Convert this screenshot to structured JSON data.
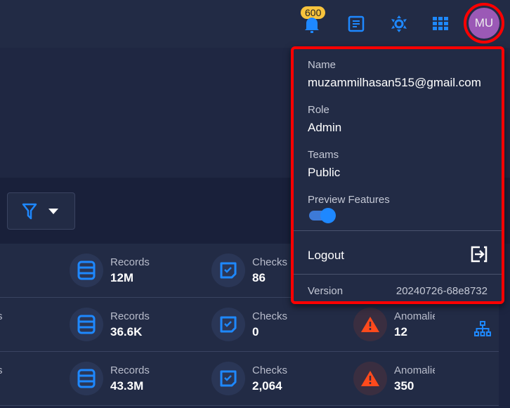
{
  "header": {
    "notification_count": "600",
    "avatar_initials": "MU",
    "icons": [
      "bell-icon",
      "document-icon",
      "theme-icon",
      "apps-grid-icon"
    ]
  },
  "rows": [
    {
      "records_label": "Records",
      "records": "12M",
      "checks_label": "Checks",
      "checks": "86",
      "edge": ""
    },
    {
      "records_label": "Records",
      "records": "36.6K",
      "checks_label": "Checks",
      "checks": "0",
      "anomalies_label": "Anomalie",
      "anomalies": "12",
      "edge": "s"
    },
    {
      "records_label": "Records",
      "records": "43.3M",
      "checks_label": "Checks",
      "checks": "2,064",
      "anomalies_label": "Anomalie",
      "anomalies": "350",
      "edge": "s"
    }
  ],
  "profile": {
    "name_label": "Name",
    "name": "muzammilhasan515@gmail.com",
    "role_label": "Role",
    "role": "Admin",
    "teams_label": "Teams",
    "teams": "Public",
    "preview_label": "Preview Features",
    "preview_enabled": true,
    "logout_label": "Logout",
    "version_label": "Version",
    "version": "20240726-68e8732"
  },
  "colors": {
    "accent": "#1e88ff",
    "warning": "#ff4a1c",
    "highlight": "#ff0000"
  }
}
